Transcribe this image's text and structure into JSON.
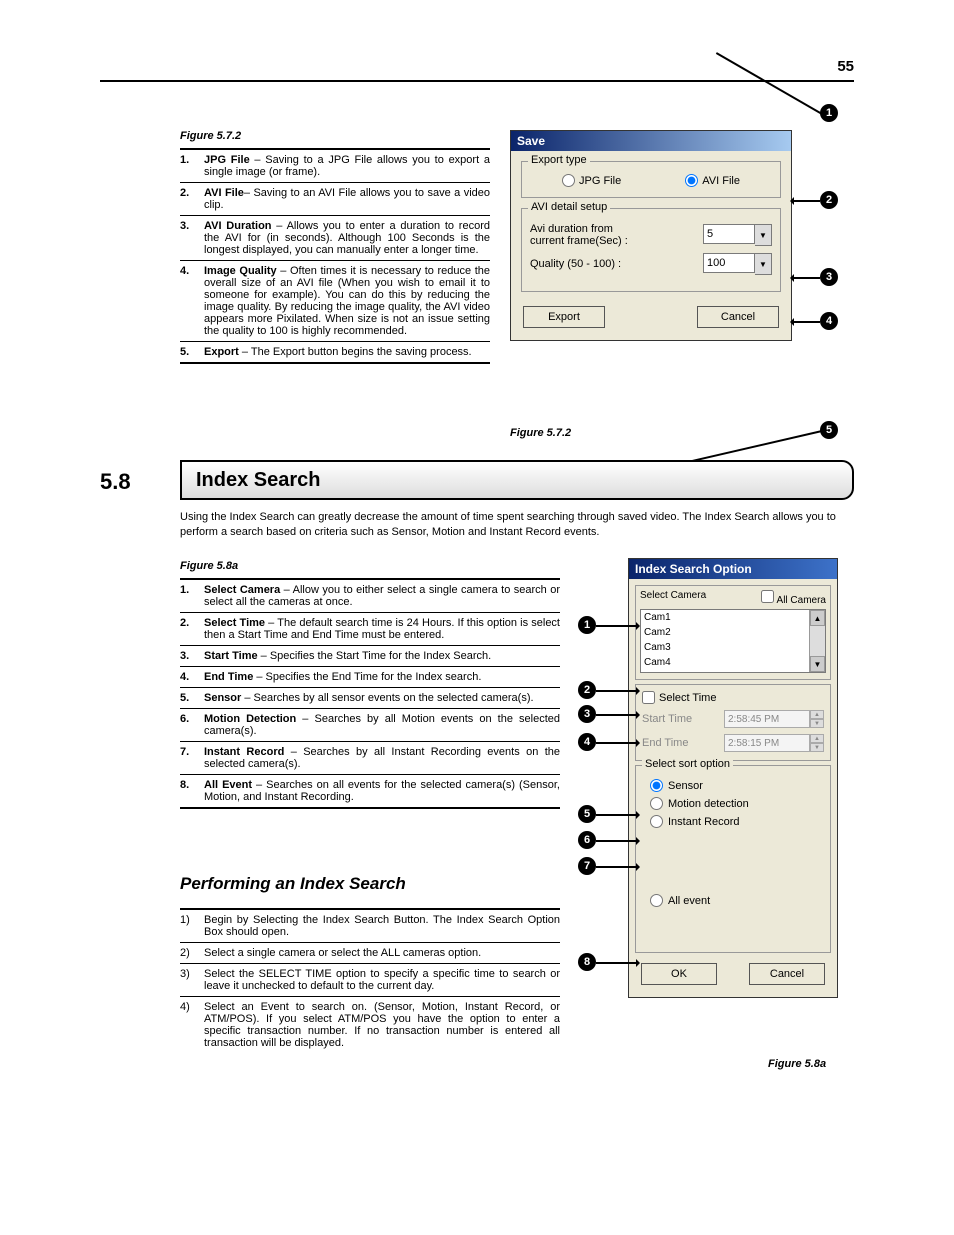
{
  "page_number": "55",
  "fig572": {
    "label": "Figure 5.7.2",
    "caption": "Figure 5.7.2",
    "items": [
      {
        "n": "1.",
        "bold": "JPG File",
        "rest": " – Saving to a JPG File allows you to export a single image (or frame)."
      },
      {
        "n": "2.",
        "bold": "AVI File",
        "rest": "– Saving to an AVI File allows you to save a video clip."
      },
      {
        "n": "3.",
        "bold": "AVI Duration",
        "rest": " – Allows you to enter a duration to record the AVI for (in seconds). Although 100 Seconds is the longest displayed, you can manually enter a longer time."
      },
      {
        "n": "4.",
        "bold": "Image Quality",
        "rest": " – Often times it is necessary to reduce the overall size of an AVI file (When you wish to email it to someone for example). You can do this by reducing the image quality. By reducing the image quality, the AVI video appears more Pixilated. When size is not an issue setting the quality to 100 is highly recommended."
      },
      {
        "n": "5.",
        "bold": "Export",
        "rest": " – The Export button begins the saving process."
      }
    ]
  },
  "save_dialog": {
    "title": "Save",
    "export_group": "Export type",
    "jpg": "JPG File",
    "avi": "AVI File",
    "avi_group": "AVI detail setup",
    "duration_label": "Avi duration from current frame(Sec) :",
    "duration_value": "5",
    "quality_label": "Quality (50 - 100) :",
    "quality_value": "100",
    "export_btn": "Export",
    "cancel_btn": "Cancel",
    "callouts": [
      "1",
      "2",
      "3",
      "4",
      "5"
    ]
  },
  "section": {
    "num": "5.8",
    "title": "Index Search",
    "intro": "Using the Index Search can greatly decrease the amount of time spent searching through saved video. The Index Search allows you to perform a search based on criteria such as Sensor, Motion and Instant Record events."
  },
  "fig58a": {
    "label": "Figure 5.8a",
    "caption": "Figure 5.8a",
    "items": [
      {
        "n": "1.",
        "bold": "Select Camera",
        "rest": " – Allow you to either select a single camera to search or select all the cameras at once."
      },
      {
        "n": "2.",
        "bold": "Select Time",
        "rest": " – The default search time is 24 Hours.  If this option is select then a Start Time and End Time must be entered."
      },
      {
        "n": "3.",
        "bold": "Start Time",
        "rest": " – Specifies the Start Time for the Index Search."
      },
      {
        "n": "4.",
        "bold": "End Time",
        "rest": " – Specifies the End Time for the Index search."
      },
      {
        "n": "5.",
        "bold": "Sensor",
        "rest": " – Searches by all sensor events on the selected camera(s)."
      },
      {
        "n": "6.",
        "bold": "Motion Detection",
        "rest": " – Searches by all Motion events on the selected camera(s)."
      },
      {
        "n": "7.",
        "bold": "Instant Record",
        "rest": " – Searches by all Instant Recording events on the selected camera(s)."
      },
      {
        "n": "8.",
        "bold": "All Event",
        "rest": " – Searches on all events for the selected camera(s) (Sensor, Motion, and Instant Recording."
      }
    ],
    "callouts": [
      "1",
      "2",
      "3",
      "4",
      "5",
      "6",
      "7",
      "8"
    ]
  },
  "performing": {
    "title": "Performing an Index Search",
    "steps": [
      {
        "n": "1)",
        "txt": "Begin by Selecting the Index Search Button. The Index Search Option Box should open."
      },
      {
        "n": "2)",
        "txt": "Select a single camera or select the ALL cameras option."
      },
      {
        "n": "3)",
        "txt": "Select the SELECT TIME option to specify a specific time to search or leave it unchecked to default to the current day."
      },
      {
        "n": "4)",
        "txt": "Select an Event to search on. (Sensor, Motion, Instant Record, or ATM/POS). If you select ATM/POS you have the option to enter a specific transaction number. If no transaction number is entered all transaction will be displayed."
      }
    ]
  },
  "idx_dialog": {
    "title": "Index Search Option",
    "select_camera": "Select Camera",
    "all_camera": "All Camera",
    "cams": [
      "Cam1",
      "Cam2",
      "Cam3",
      "Cam4"
    ],
    "select_time": "Select Time",
    "start_label": "Start Time",
    "start_value": "2:58:45 PM",
    "end_label": "End Time",
    "end_value": "2:58:15 PM",
    "sort_group": "Select sort option",
    "sensor": "Sensor",
    "motion": "Motion detection",
    "instant": "Instant Record",
    "allevent": "All event",
    "ok": "OK",
    "cancel": "Cancel"
  }
}
